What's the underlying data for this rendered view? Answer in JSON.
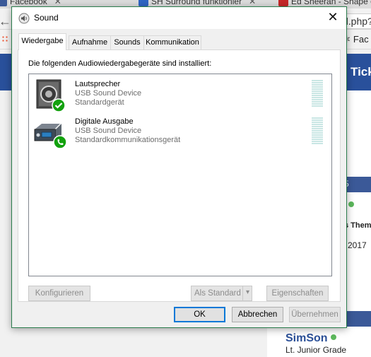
{
  "browser": {
    "tabs": [
      {
        "label": "Facebook",
        "color": "#3b5998"
      },
      {
        "label": "SH Surround funktionier",
        "color": "#2f66c4"
      },
      {
        "label": "Ed Sheeran - Shape o",
        "color": "#c62828"
      }
    ],
    "url_fragment": "d.php?",
    "bookmark_label": "Fac",
    "page": {
      "header_text": "Tick",
      "strip_text": "5",
      "themen_text": "s Them",
      "year_text": "2017",
      "strip2_text": "0",
      "username": "SimSon",
      "rank": "Lt. Junior Grade"
    }
  },
  "dialog": {
    "title": "Sound",
    "tabs": [
      {
        "label": "Wiedergabe",
        "active": true
      },
      {
        "label": "Aufnahme",
        "active": false
      },
      {
        "label": "Sounds",
        "active": false
      },
      {
        "label": "Kommunikation",
        "active": false
      }
    ],
    "heading": "Die folgenden Audiowiedergabegeräte sind installiert:",
    "devices": [
      {
        "name": "Lautsprecher",
        "type": "USB Sound Device",
        "status": "Standardgerät",
        "icon": "speaker-icon",
        "badge": "check-badge-icon"
      },
      {
        "name": "Digitale Ausgabe",
        "type": "USB Sound Device",
        "status": "Standardkommunikationsgerät",
        "icon": "digital-output-icon",
        "badge": "phone-badge-icon"
      }
    ],
    "buttons": {
      "configure": "Konfigurieren",
      "set_default": "Als Standard",
      "properties": "Eigenschaften",
      "ok": "OK",
      "cancel": "Abbrechen",
      "apply": "Übernehmen"
    },
    "colors": {
      "accent": "#0078d7",
      "badge_green": "#13a10e",
      "meter": "#c9e6e4",
      "frame": "#2b7d4d"
    }
  }
}
